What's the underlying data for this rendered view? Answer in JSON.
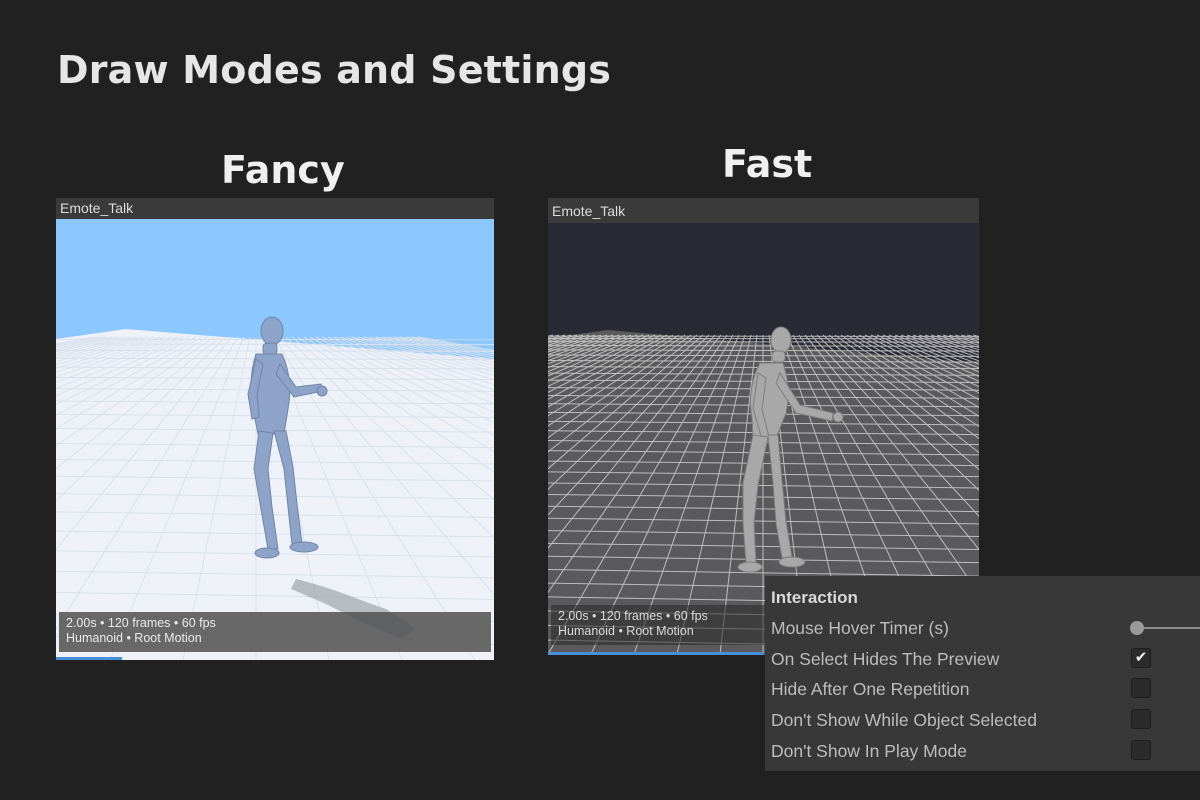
{
  "page": {
    "title": "Draw Modes and Settings"
  },
  "modes": [
    {
      "label": "Fancy",
      "panel": {
        "header": "Emote_Talk",
        "info_line1": "2.00s  •  120 frames  •  60 fps",
        "info_line2": "Humanoid  •  Root Motion",
        "progress": 0.15
      }
    },
    {
      "label": "Fast",
      "panel": {
        "header": "Emote_Talk",
        "info_line1": "2.00s  •  120 frames  •  60 fps",
        "info_line2": "Humanoid  •  Root Motion",
        "progress": 0.5
      }
    }
  ],
  "settings": {
    "title": "Interaction",
    "rows": [
      {
        "label": "Mouse Hover Timer (s)",
        "control": "slider",
        "value": 0
      },
      {
        "label": "On Select Hides The Preview",
        "control": "checkbox",
        "checked": true
      },
      {
        "label": "Hide After One Repetition",
        "control": "checkbox",
        "checked": false
      },
      {
        "label": "Don't Show While Object Selected",
        "control": "checkbox",
        "checked": false
      },
      {
        "label": "Don't Show In Play Mode",
        "control": "checkbox",
        "checked": false
      }
    ]
  },
  "colors": {
    "background": "#212121",
    "sky_fancy": "#8cc8fd",
    "sky_fast": "#2a2a35",
    "accent": "#4a90d9"
  }
}
